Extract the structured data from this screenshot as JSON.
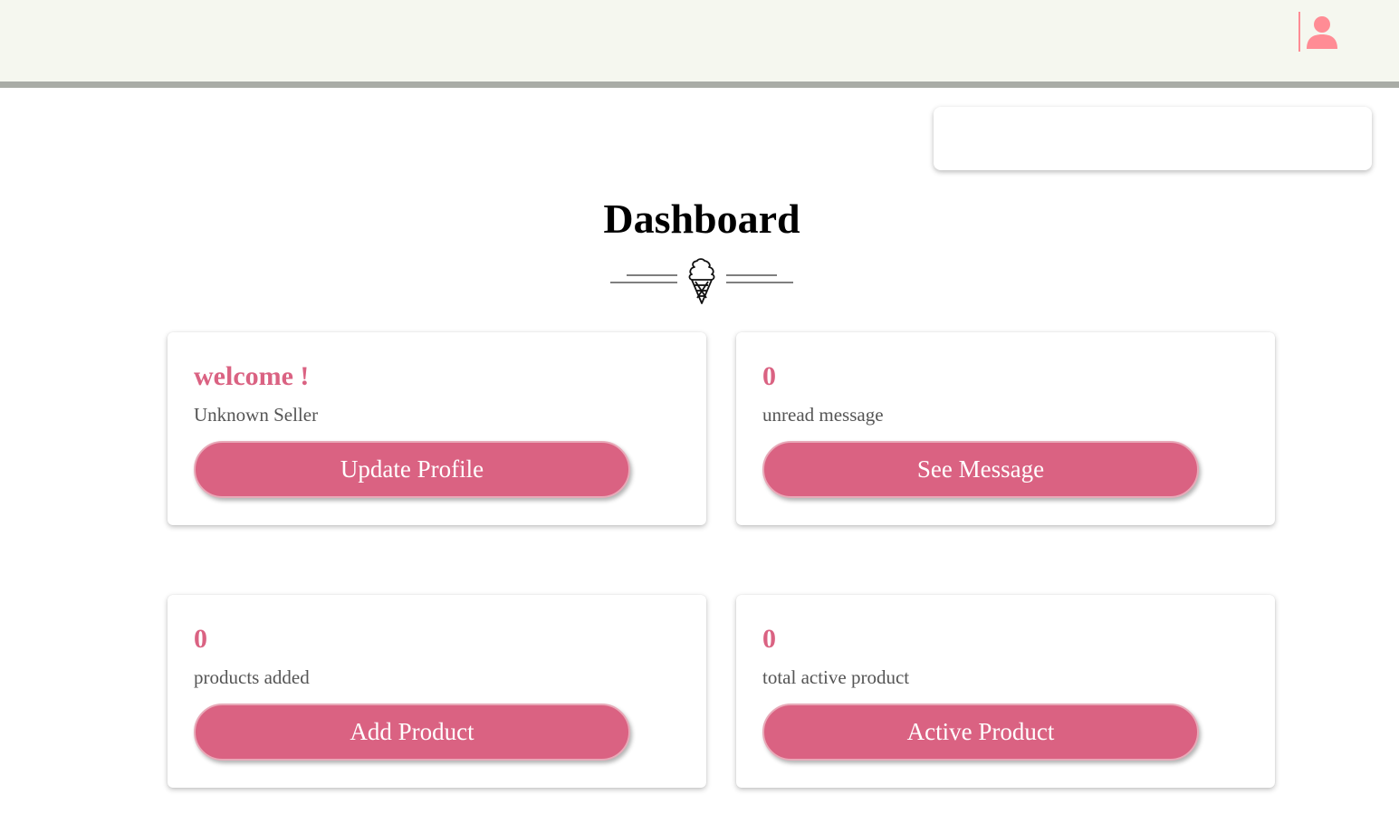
{
  "header": {
    "background": "#f5f7ef",
    "border_color": "#a9aca6",
    "user_icon": "user-icon",
    "accent": "#ff8c95"
  },
  "search": {
    "placeholder": ""
  },
  "page": {
    "title": "Dashboard",
    "ornament_icon": "ice-cream-icon"
  },
  "theme": {
    "primary": "#da6282",
    "text_muted": "#555555"
  },
  "cards": [
    {
      "value": "welcome !",
      "label": "Unknown Seller",
      "button": "Update Profile"
    },
    {
      "value": "0",
      "label": "unread message",
      "button": "See Message"
    },
    {
      "value": "0",
      "label": "products added",
      "button": "Add Product"
    },
    {
      "value": "0",
      "label": "total active product",
      "button": "Active Product"
    }
  ]
}
